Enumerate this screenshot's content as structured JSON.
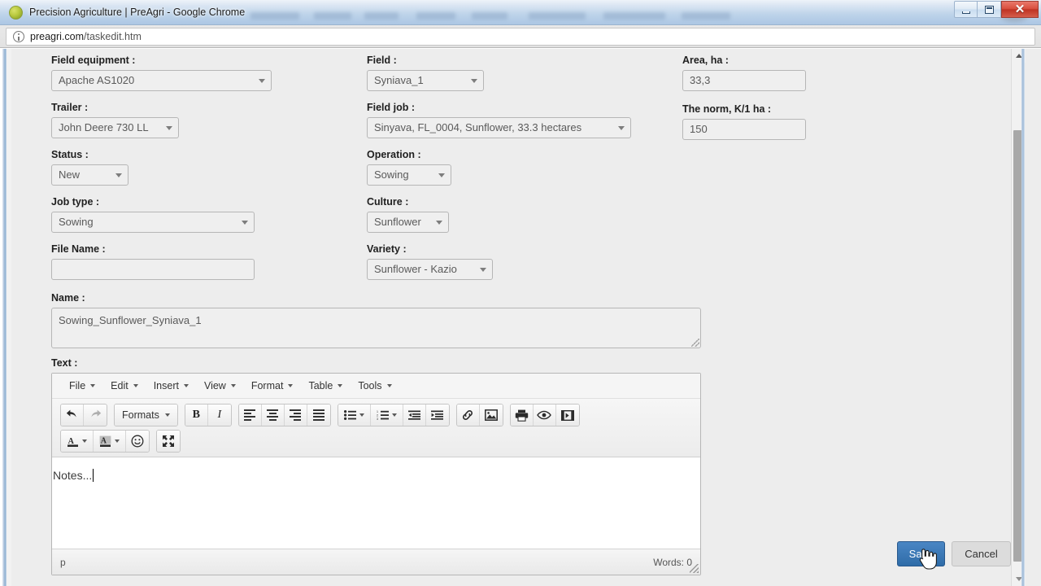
{
  "window": {
    "title": "Precision Agriculture | PreAgri - Google Chrome",
    "favicon": "preagri-leaf-icon",
    "minimize_label": "",
    "maximize_label": "",
    "close_label": "✕"
  },
  "omnibox": {
    "host": "preagri.com",
    "path": "/taskedit.htm",
    "security_icon": "info-circle-icon"
  },
  "form": {
    "field_equipment": {
      "label": "Field equipment :",
      "value": "Apache AS1020"
    },
    "trailer": {
      "label": "Trailer :",
      "value": "John Deere 730 LL"
    },
    "status": {
      "label": "Status :",
      "value": "New"
    },
    "job_type": {
      "label": "Job type :",
      "value": "Sowing"
    },
    "file_name": {
      "label": "File Name :",
      "value": ""
    },
    "field": {
      "label": "Field :",
      "value": "Syniava_1"
    },
    "field_job": {
      "label": "Field job :",
      "value": "Sinyava, FL_0004, Sunflower, 33.3 hectares"
    },
    "operation": {
      "label": "Operation :",
      "value": "Sowing"
    },
    "culture": {
      "label": "Culture :",
      "value": "Sunflower"
    },
    "variety": {
      "label": "Variety :",
      "value": "Sunflower - Kazio"
    },
    "area": {
      "label": "Area, ha :",
      "value": "33,3"
    },
    "norm": {
      "label": "The norm, K/1 ha :",
      "value": "150"
    },
    "name": {
      "label": "Name :",
      "value": "Sowing_Sunflower_Syniava_1"
    },
    "text": {
      "label": "Text :"
    }
  },
  "editor": {
    "menu": [
      {
        "label": "File"
      },
      {
        "label": "Edit"
      },
      {
        "label": "Insert"
      },
      {
        "label": "View"
      },
      {
        "label": "Format"
      },
      {
        "label": "Table"
      },
      {
        "label": "Tools"
      }
    ],
    "formats_label": "Formats",
    "bold_label": "B",
    "italic_label": "I",
    "content": "Notes...",
    "statusbar_path": "p",
    "word_count": "Words: 0"
  },
  "actions": {
    "save_label": "Save",
    "cancel_label": "Cancel"
  },
  "colors": {
    "accent": "#2f6ca8",
    "page_bg": "#ededed",
    "field_bg": "#efefef",
    "field_border": "#b6b6b6",
    "close_button": "#bf3323"
  }
}
